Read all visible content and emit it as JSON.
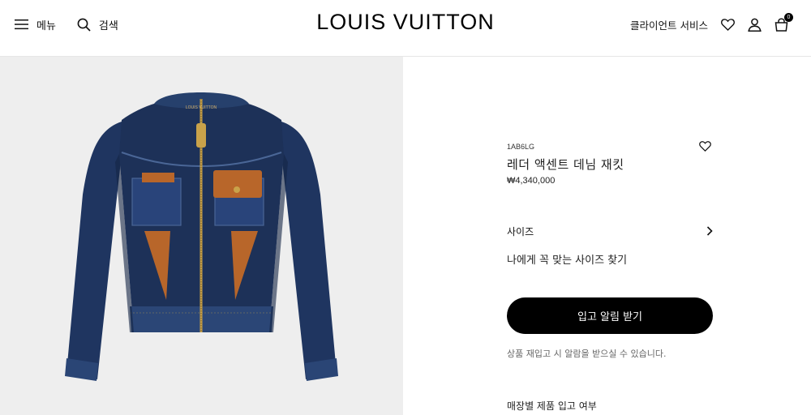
{
  "header": {
    "menu_label": "메뉴",
    "search_label": "검색",
    "brand": "LOUIS VUITTON",
    "client_services_label": "클라이언트 서비스",
    "cart_count": "0"
  },
  "product_image": {
    "neck_label": "LOUIS VUITTON"
  },
  "product": {
    "sku": "1AB6LG",
    "name": "레더 액센트 데님 재킷",
    "price": "₩4,340,000"
  },
  "size": {
    "label": "사이즈",
    "guide_link": "나에게 꼭 맞는 사이즈 찾기"
  },
  "restock": {
    "button_label": "입고 알림 받기",
    "note": "상품 재입고 시 알람을 받으실 수 있습니다."
  },
  "store_stock": {
    "label": "매장별 제품 입고 여부"
  },
  "colors": {
    "denim": "#1f3560",
    "leather": "#b8662a",
    "zipper": "#c9a24a",
    "media_bg": "#eeeeee"
  }
}
